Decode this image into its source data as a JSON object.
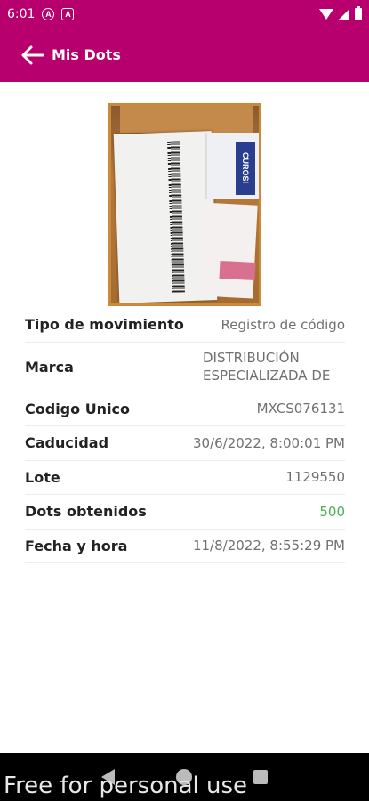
{
  "status_bar": {
    "time": "6:01",
    "notification_icons": [
      "A",
      "A"
    ]
  },
  "app_bar": {
    "title": "Mis Dots"
  },
  "photo": {
    "box_text": "CUROSI"
  },
  "details": [
    {
      "label": "Tipo de movimiento",
      "value": "Registro de código"
    },
    {
      "label": "Marca",
      "value": "DISTRIBUCIÓN ESPECIALIZADA DE"
    },
    {
      "label": "Codigo Unico",
      "value": "MXCS076131"
    },
    {
      "label": "Caducidad",
      "value": "30/6/2022, 8:00:01 PM"
    },
    {
      "label": "Lote",
      "value": "1129550"
    },
    {
      "label": "Dots obtenidos",
      "value": "500"
    },
    {
      "label": "Fecha y hora",
      "value": "11/8/2022, 8:55:29 PM"
    }
  ],
  "watermark": "Free for personal use",
  "colors": {
    "primary": "#b7006d",
    "dots_value": "#4caf50"
  }
}
